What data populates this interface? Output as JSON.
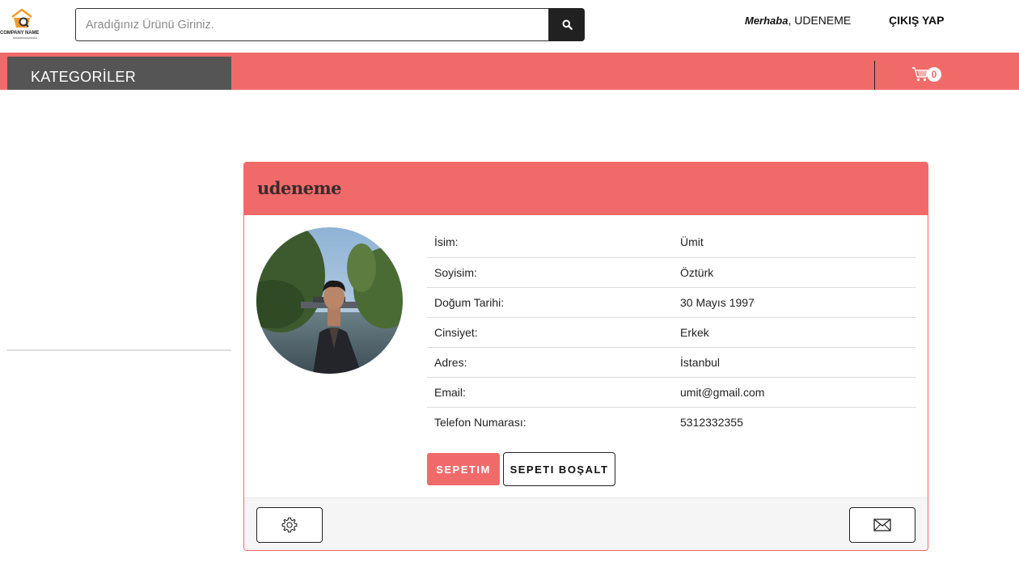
{
  "header": {
    "logo": {
      "icon": "basket-logo-icon",
      "name": "COMPANY NAME"
    },
    "search": {
      "placeholder": "Aradığınız Ürünü Giriniz.",
      "value": "",
      "button_icon": "search-icon"
    },
    "greeting": {
      "prefix": "Merhaba",
      "separator": ", ",
      "username": "UDENEME"
    },
    "logout_label": "ÇIKIŞ YAP"
  },
  "navbar": {
    "categories_label": "KATEGORİLER",
    "cart": {
      "icon": "cart-icon",
      "count": "0"
    }
  },
  "profile": {
    "title": "udeneme",
    "avatar_icon": "profile-photo",
    "rows": [
      {
        "label": "İsim:",
        "value": "Ümit"
      },
      {
        "label": "Soyisim:",
        "value": "Öztürk"
      },
      {
        "label": "Doğum Tarihi:",
        "value": "30 Mayıs 1997"
      },
      {
        "label": "Cinsiyet:",
        "value": "Erkek"
      },
      {
        "label": "Adres:",
        "value": "İstanbul"
      },
      {
        "label": "Email:",
        "value": "umit@gmail.com"
      },
      {
        "label": "Telefon Numarası:",
        "value": "5312332355"
      }
    ],
    "buttons": {
      "cart_label": "SEPETIM",
      "empty_cart_label": "SEPETI BOŞALT"
    },
    "footer": {
      "settings_icon": "gear-icon",
      "mail_icon": "envelope-icon"
    }
  },
  "colors": {
    "accent": "#f16a6a",
    "category_bg": "#555555",
    "dark_button": "#212121"
  }
}
